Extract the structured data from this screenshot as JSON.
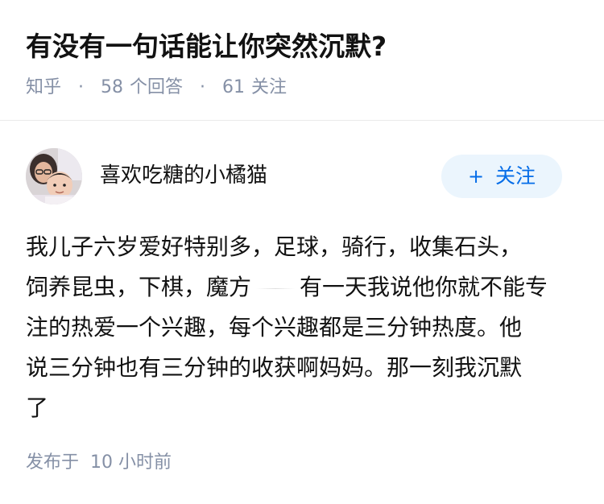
{
  "question": {
    "title": "有没有一句话能让你突然沉默?",
    "source": "知乎",
    "answers_count": "58",
    "answers_label": "个回答",
    "followers_count": "61",
    "followers_label": "关注",
    "separator": "·"
  },
  "author": {
    "name": "喜欢吃糖的小橘猫",
    "avatar_icon": "avatar-photo",
    "follow_label": "关注",
    "follow_icon": "plus-icon",
    "follow_plus": "+"
  },
  "answer": {
    "lines": [
      "我儿子六岁爱好特别多，足球，骑行，收集石头，",
      "饲养昆虫，下棋，魔方",
      "有一天我说他你就不能专",
      "注的热爱一个兴趣，每个兴趣都是三分钟热度。他",
      "说三分钟也有三分钟的收获啊妈妈。那一刻我沉默",
      "了"
    ]
  },
  "footer": {
    "published_label": "发布于",
    "published_time": "10 小时前"
  },
  "colors": {
    "title": "#121212",
    "meta": "#8590a6",
    "follow_bg": "#ebf5fd",
    "follow_text": "#056de8",
    "divider": "#ebebeb"
  }
}
